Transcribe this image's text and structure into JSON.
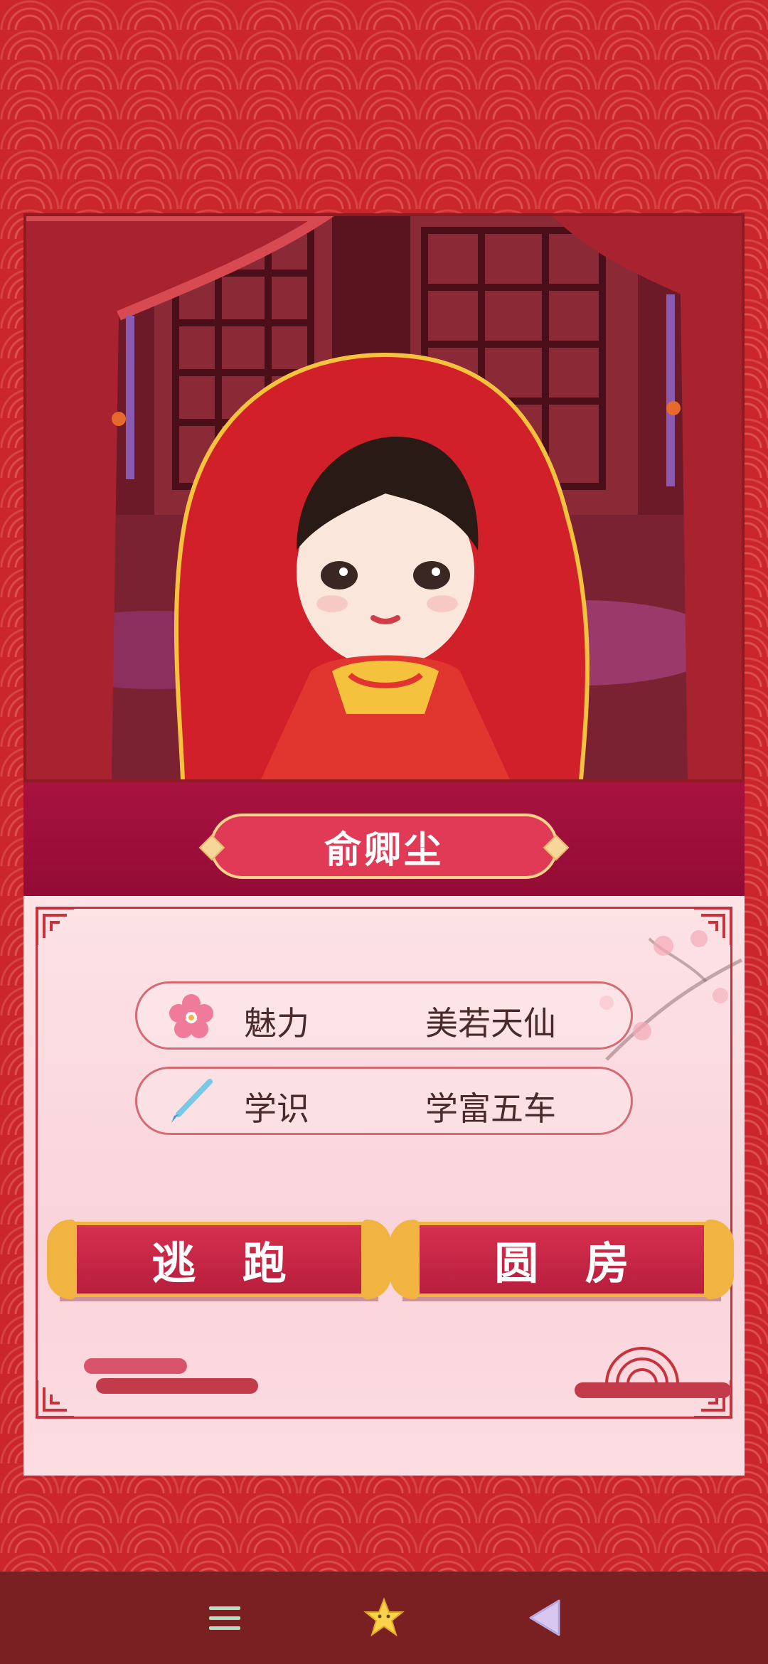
{
  "character": {
    "name": "俞卿尘"
  },
  "stats": [
    {
      "icon": "plum-blossom-icon",
      "label": "魅力",
      "value": "美若天仙"
    },
    {
      "icon": "brush-icon",
      "label": "学识",
      "value": "学富五车"
    }
  ],
  "actions": {
    "escape_label": "逃 跑",
    "consummate_label": "圆 房"
  },
  "navbar": {
    "menu_icon": "menu-icon",
    "star_icon": "star-icon",
    "back_icon": "back-icon"
  },
  "colors": {
    "primary_red": "#cb262c",
    "panel_pink": "#fde3e6",
    "gold": "#f2b441",
    "band": "#a8123f"
  }
}
